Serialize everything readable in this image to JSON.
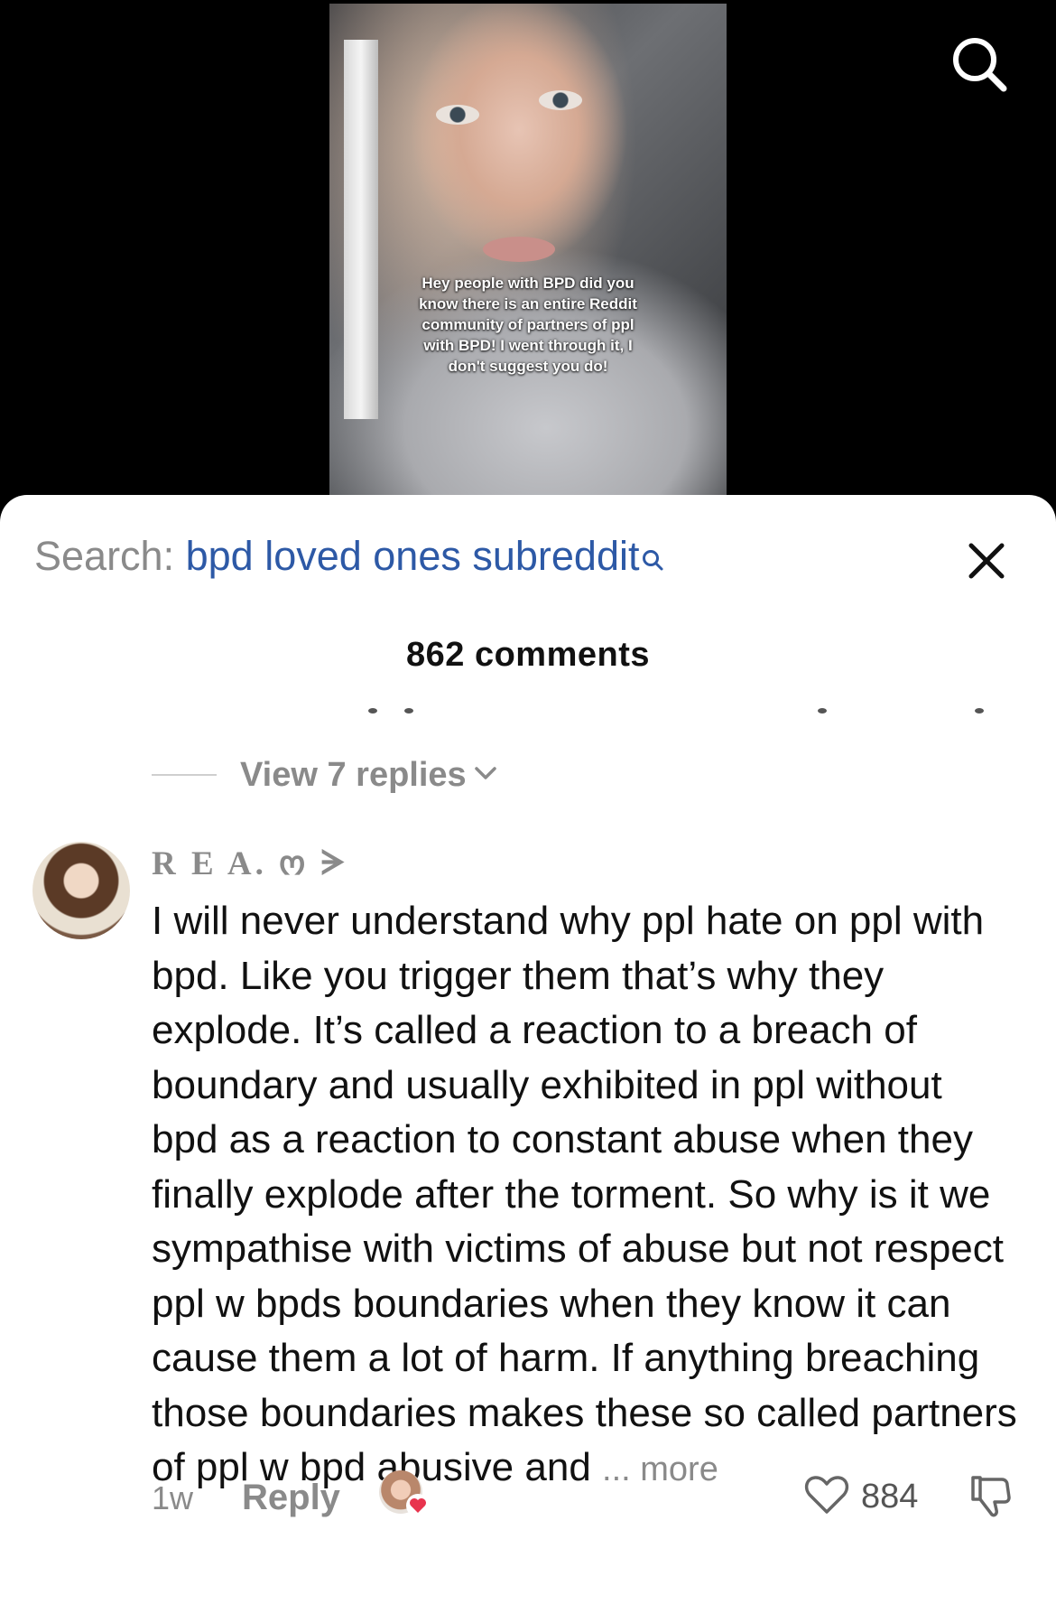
{
  "video": {
    "caption": "Hey people with BPD did you know there is an entire Reddit community of partners of ppl with BPD! I went through it, I don't suggest you do!"
  },
  "top_bar": {
    "search_icon": "search-icon"
  },
  "comments_sheet": {
    "search_prefix": "Search:",
    "search_query": "bpd loved ones subreddit",
    "search_query_icon": "search-icon",
    "close_icon": "close-icon",
    "count_label": "862 comments",
    "view_replies": "View 7 replies",
    "comment": {
      "username": "R E A. ო ᗒ",
      "text": "I will never understand why ppl hate on ppl with bpd. Like you trigger them that’s why they explode. It’s called a reaction to a breach of boundary and usually exhibited in ppl without bpd as a reaction to constant abuse when they finally explode after the torment. So why is it we sympathise with victims of abuse but not respect ppl w bpds boundaries when they know it can cause them a lot of harm. If anything breaching those boundaries makes these so called partners of ppl w bpd abusive and",
      "more_label": "... more",
      "time": "1w",
      "reply_label": "Reply",
      "like_count": "884",
      "like_icon": "heart-outline-icon",
      "dislike_icon": "thumbs-down-icon",
      "accent": "#2d59a6",
      "heart_color": "#e8344e"
    }
  }
}
